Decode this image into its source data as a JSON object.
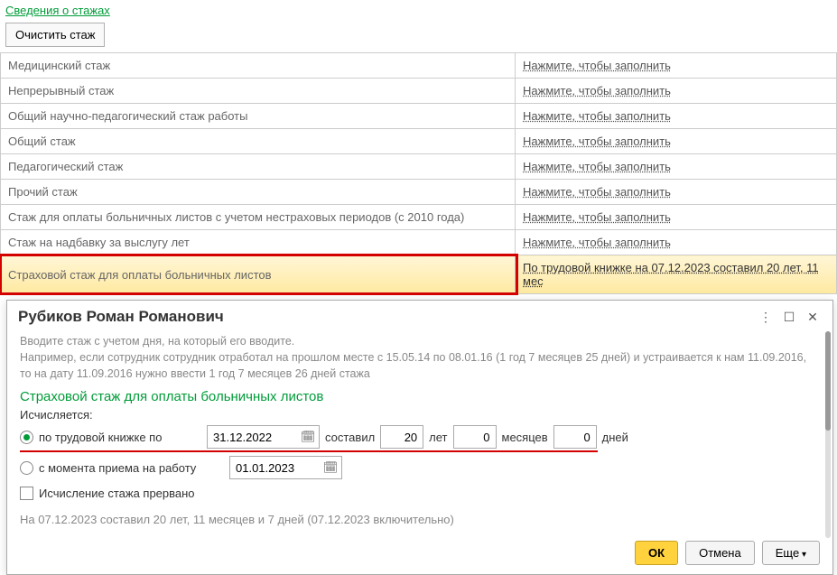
{
  "header": {
    "title": "Сведения о стажах",
    "clear_btn": "Очистить стаж"
  },
  "table": {
    "fill_link": "Нажмите, чтобы заполнить",
    "rows": [
      {
        "name": "Медицинский стаж"
      },
      {
        "name": "Непрерывный стаж"
      },
      {
        "name": "Общий научно-педагогический стаж работы"
      },
      {
        "name": "Общий стаж"
      },
      {
        "name": "Педагогический стаж"
      },
      {
        "name": "Прочий стаж"
      },
      {
        "name": "Стаж для оплаты больничных листов с учетом нестраховых периодов (с 2010 года)"
      },
      {
        "name": "Стаж на надбавку за выслугу лет"
      }
    ],
    "highlight": {
      "name": "Страховой стаж для оплаты больничных листов",
      "link": "По трудовой книжке на 07.12.2023 составил 20 лет, 11 мес"
    }
  },
  "dialog": {
    "title": "Рубиков Роман Романович",
    "help1": "Вводите стаж с учетом дня, на который его вводите.",
    "help2": "Например, если сотрудник сотрудник отработал на прошлом месте с 15.05.14 по 08.01.16 (1 год 7 месяцев 25 дней) и устраивается к нам 11.09.2016, то на дату 11.09.2016 нужно ввести 1 год 7 месяцев 26 дней стажа",
    "section": "Страховой стаж для оплаты больничных листов",
    "calc_label": "Исчисляется:",
    "opt1": "по трудовой книжке по",
    "opt2": "с момента приема на работу",
    "date1": "31.12.2022",
    "date2": "01.01.2023",
    "lbl_made": "составил",
    "lbl_years": "лет",
    "lbl_months": "месяцев",
    "lbl_days": "дней",
    "val_years": "20",
    "val_months": "0",
    "val_days": "0",
    "interrupted": "Исчисление стажа прервано",
    "result": "На 07.12.2023 составил 20 лет, 11 месяцев и 7 дней (07.12.2023 включительно)",
    "btn_ok": "ОК",
    "btn_cancel": "Отмена",
    "btn_more": "Еще"
  }
}
